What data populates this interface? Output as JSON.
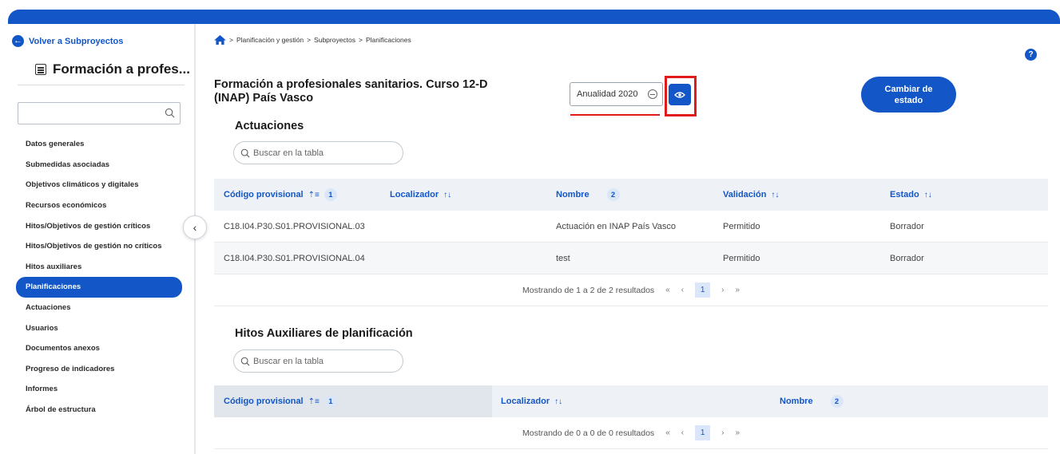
{
  "sidebar": {
    "back_label": "Volver a Subproyectos",
    "project_title": "Formación a profes...",
    "search_placeholder": "",
    "items": [
      {
        "label": "Datos generales"
      },
      {
        "label": "Submedidas asociadas"
      },
      {
        "label": "Objetivos climáticos y digitales"
      },
      {
        "label": "Recursos económicos"
      },
      {
        "label": "Hitos/Objetivos de gestión críticos"
      },
      {
        "label": "Hitos/Objetivos de gestión no críticos"
      },
      {
        "label": "Hitos auxiliares"
      },
      {
        "label": "Planificaciones",
        "active": true
      },
      {
        "label": "Actuaciones"
      },
      {
        "label": "Usuarios"
      },
      {
        "label": "Documentos anexos"
      },
      {
        "label": "Progreso de indicadores"
      },
      {
        "label": "Informes"
      },
      {
        "label": "Árbol de estructura"
      }
    ]
  },
  "breadcrumb": {
    "items": [
      "Planificación y gestión",
      "Subproyectos",
      "Planificaciones"
    ],
    "separator": ">"
  },
  "header": {
    "title": "Formación a profesionales sanitarios. Curso 12-D (INAP) País Vasco",
    "year_value": "Anualidad 2020",
    "state_button": "Cambiar de estado"
  },
  "actuaciones": {
    "title": "Actuaciones",
    "search_placeholder": "Buscar en la tabla",
    "columns": [
      {
        "label": "Código provisional",
        "badge": "1"
      },
      {
        "label": "Localizador"
      },
      {
        "label": "Nombre",
        "badge": "2"
      },
      {
        "label": "Validación"
      },
      {
        "label": "Estado"
      }
    ],
    "rows": [
      {
        "codigo": "C18.I04.P30.S01.PROVISIONAL.03",
        "localizador": "",
        "nombre": "Actuación en INAP País Vasco",
        "validacion": "Permitido",
        "estado": "Borrador"
      },
      {
        "codigo": "C18.I04.P30.S01.PROVISIONAL.04",
        "localizador": "",
        "nombre": "test",
        "validacion": "Permitido",
        "estado": "Borrador"
      }
    ],
    "pager_text": "Mostrando de 1 a 2 de 2 resultados",
    "current_page": "1"
  },
  "hitos": {
    "title": "Hitos Auxiliares de planificación",
    "search_placeholder": "Buscar en la tabla",
    "columns": [
      {
        "label": "Código provisional",
        "badge": "1"
      },
      {
        "label": "Localizador"
      },
      {
        "label": "Nombre",
        "badge": "2"
      }
    ],
    "pager_text": "Mostrando de 0 a 0 de 0 resultados",
    "current_page": "1"
  },
  "colors": {
    "primary": "#1256c8",
    "highlight_red": "#e01b1b"
  },
  "icons": [
    "arrow-left-icon",
    "ledger-icon",
    "search-icon",
    "home-icon",
    "help-icon",
    "eye-icon",
    "clear-circle-icon",
    "chevron-left-icon",
    "sort-icon"
  ]
}
